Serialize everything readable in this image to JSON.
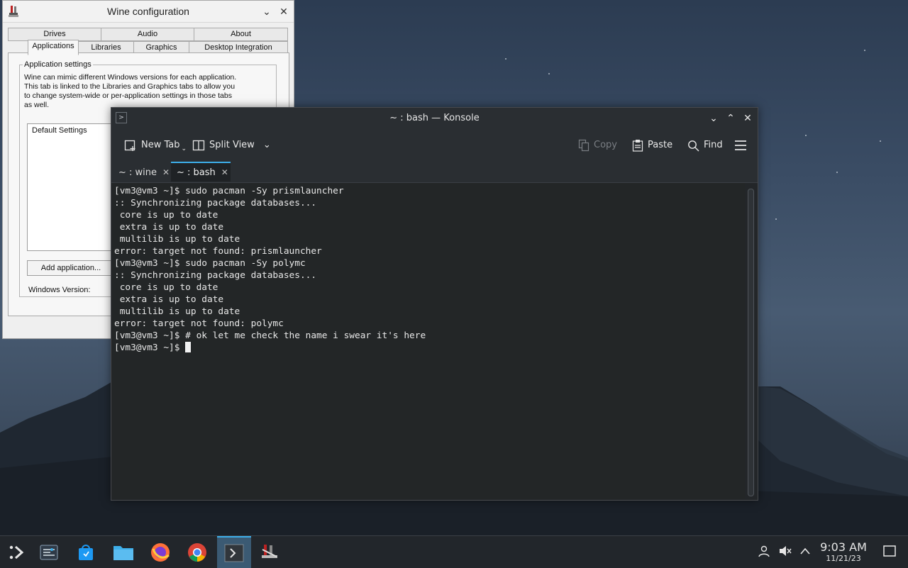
{
  "wine": {
    "title": "Wine configuration",
    "tabs_row1": [
      "Drives",
      "Audio",
      "About"
    ],
    "tabs_row2": [
      "Applications",
      "Libraries",
      "Graphics",
      "Desktop Integration"
    ],
    "active_tab": "Applications",
    "group_label": "Application settings",
    "description_lines": [
      "Wine can mimic different Windows versions for each application.",
      "This tab is linked to the Libraries and Graphics tabs to allow you",
      "to change system-wide or per-application settings in those tabs",
      "as well."
    ],
    "list_items": [
      "Default Settings"
    ],
    "add_button": "Add application...",
    "windows_version_label": "Windows Version:"
  },
  "konsole": {
    "title": "~ : bash — Konsole",
    "toolbar": {
      "new_tab": "New Tab",
      "split_view": "Split View",
      "copy": "Copy",
      "paste": "Paste",
      "find": "Find"
    },
    "tabs": [
      {
        "label": "~ : wine",
        "active": false
      },
      {
        "label": "~ : bash",
        "active": true
      }
    ],
    "terminal_lines": [
      "[vm3@vm3 ~]$ sudo pacman -Sy prismlauncher",
      ":: Synchronizing package databases...",
      " core is up to date",
      " extra is up to date",
      " multilib is up to date",
      "error: target not found: prismlauncher",
      "[vm3@vm3 ~]$ sudo pacman -Sy polymc",
      ":: Synchronizing package databases...",
      " core is up to date",
      " extra is up to date",
      " multilib is up to date",
      "error: target not found: polymc",
      "[vm3@vm3 ~]$ # ok let me check the name i swear it's here"
    ],
    "prompt": "[vm3@vm3 ~]$ "
  },
  "taskbar": {
    "apps": [
      "application-launcher-icon",
      "settings-icon",
      "discover-store-icon",
      "file-manager-icon",
      "firefox-icon",
      "chrome-icon",
      "konsole-icon",
      "wine-icon"
    ],
    "active_app": "konsole-icon",
    "clock_time": "9:03 AM",
    "clock_date": "11/21/23"
  },
  "colors": {
    "accent": "#3daee9",
    "terminal_bg": "#232627",
    "panel_bg": "#22262b"
  }
}
